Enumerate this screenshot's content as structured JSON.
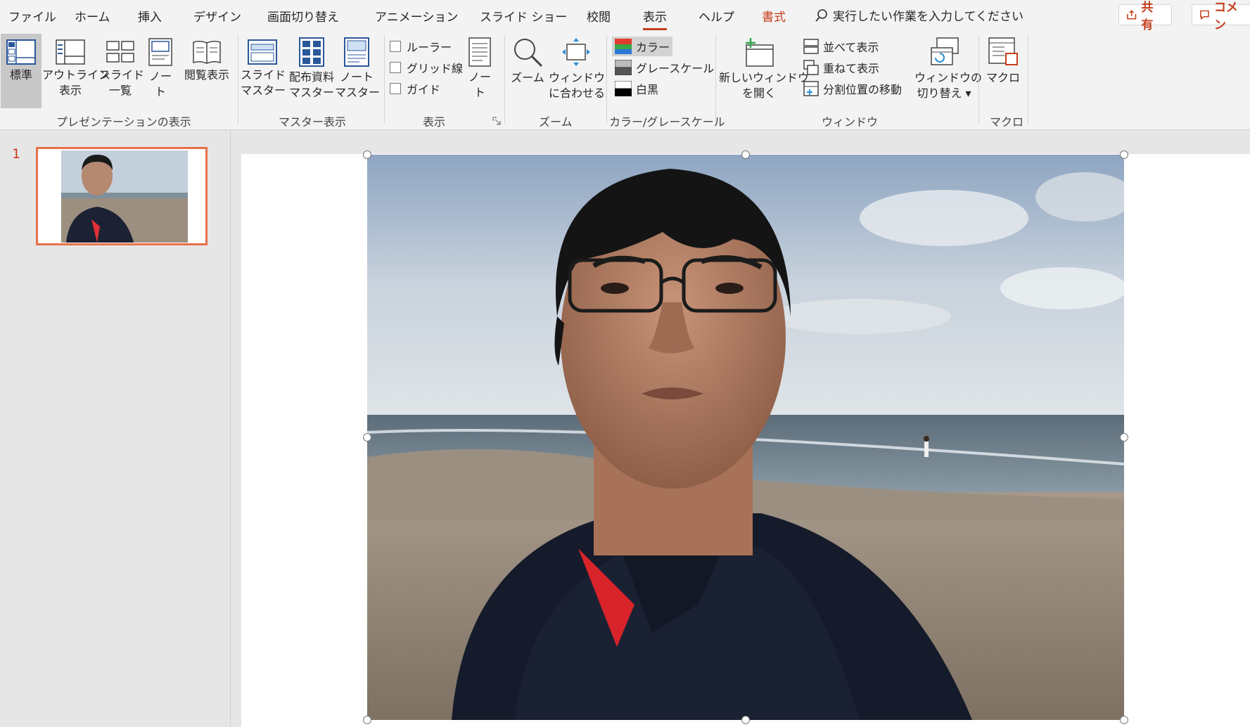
{
  "menu": {
    "tabs": [
      "ファイル",
      "ホーム",
      "挿入",
      "デザイン",
      "画面切り替え",
      "アニメーション",
      "スライド ショー",
      "校閲",
      "表示",
      "ヘルプ",
      "書式"
    ],
    "active_tab": "表示",
    "tell_me": "実行したい作業を入力してください",
    "share": "共有",
    "comments": "コメン"
  },
  "ribbon": {
    "presentation_views": {
      "group": "プレゼンテーションの表示",
      "normal": "標準",
      "outline": "アウトライン\n表示",
      "sorter": "スライド\n一覧",
      "notes": "ノー\nト",
      "reading": "閲覧表示"
    },
    "master_views": {
      "group": "マスター表示",
      "slide_master": "スライド\nマスター",
      "handout_master": "配布資料\nマスター",
      "notes_master": "ノート\nマスター"
    },
    "show": {
      "group": "表示",
      "ruler": "ルーラー",
      "gridlines": "グリッド線",
      "guides": "ガイド",
      "notes": "ノー\nト"
    },
    "zoom": {
      "group": "ズーム",
      "zoom": "ズーム",
      "fit": "ウィンドウ\nに合わせる"
    },
    "color": {
      "group": "カラー/グレースケール",
      "color": "カラー",
      "grayscale": "グレースケール",
      "bw": "白黒"
    },
    "window": {
      "group": "ウィンドウ",
      "new_window": "新しいウィンドウ\nを開く",
      "arrange": "並べて表示",
      "cascade": "重ねて表示",
      "move_split": "分割位置の移動",
      "switch": "ウィンドウの\n切り替え ▾"
    },
    "macros": {
      "group": "マクロ",
      "macros": "マクロ"
    }
  },
  "slides": {
    "current_number": "1"
  },
  "colors": {
    "accent": "#c43e1c",
    "thumb_border": "#e8704a",
    "ribbon_bg": "#f3f3f3",
    "workspace_bg": "#e6e6e6"
  }
}
